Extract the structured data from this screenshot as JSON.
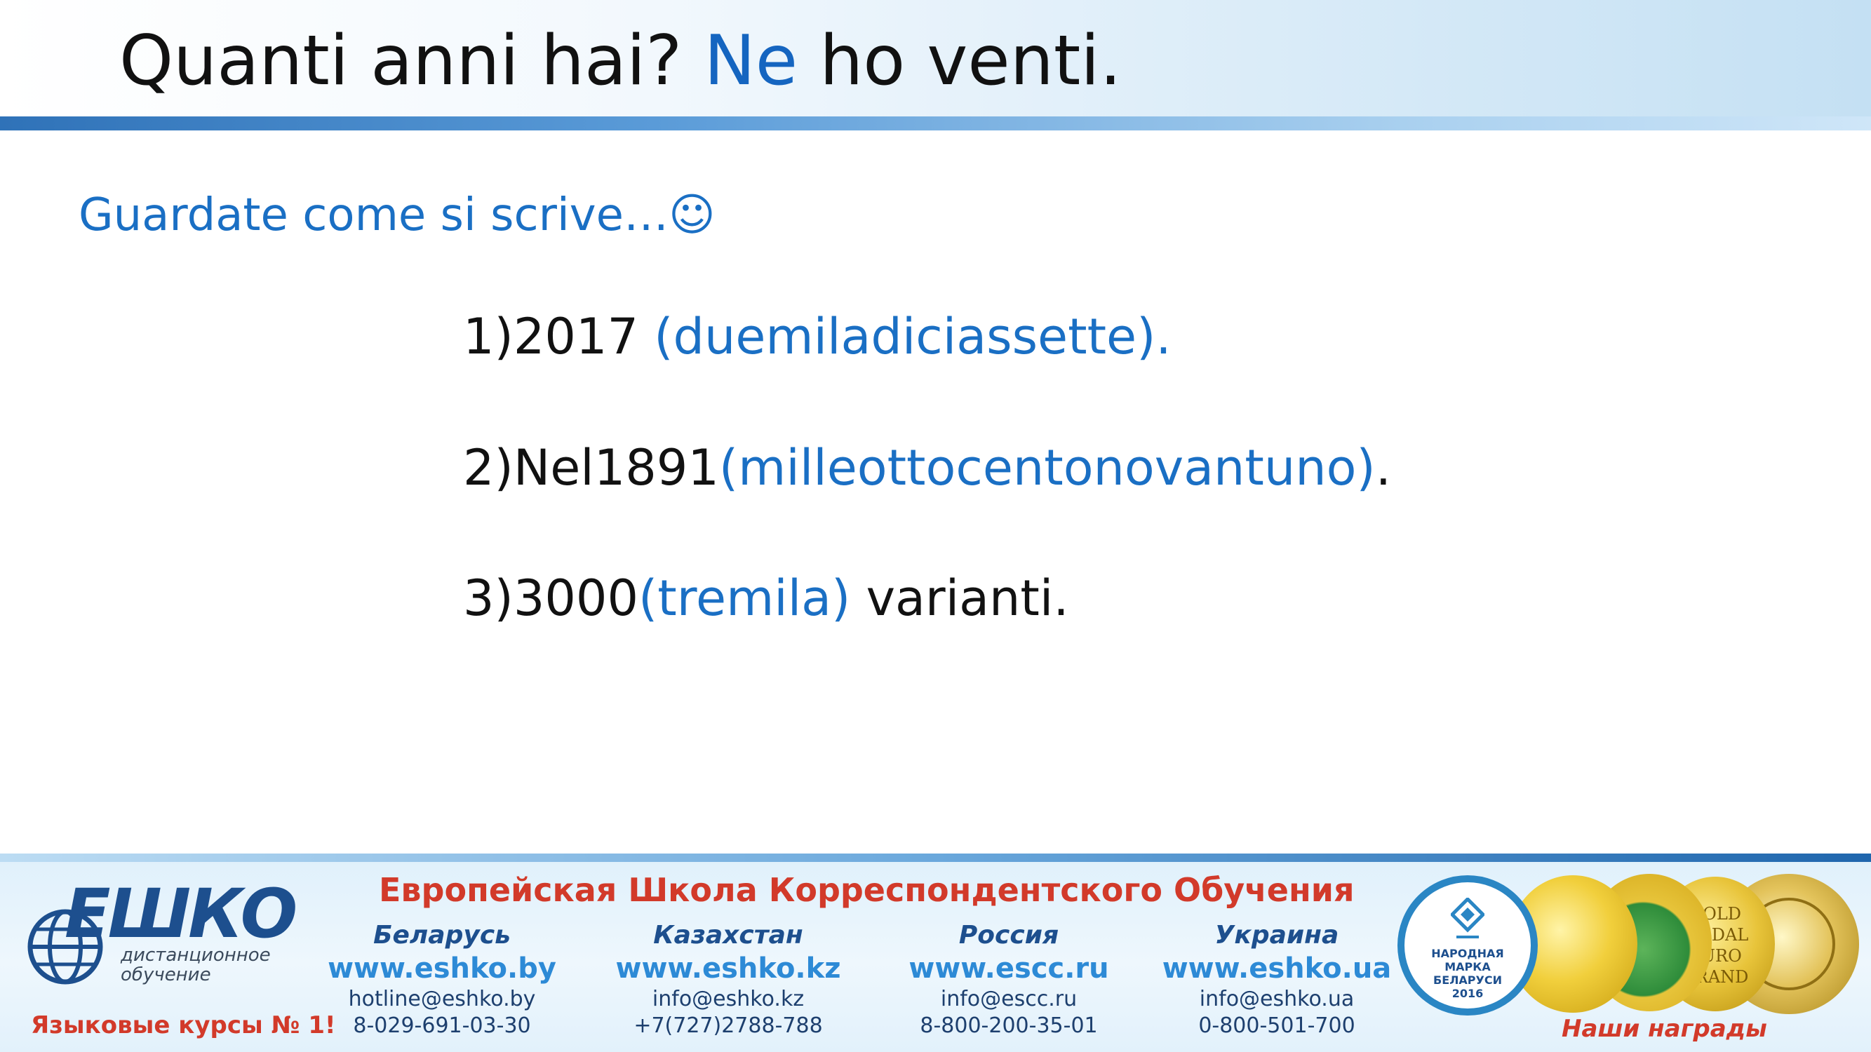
{
  "slide": {
    "title_part1": "Quanti anni hai? ",
    "title_highlight": "Ne",
    "title_part2": " ho venti.",
    "subtitle": "Guardate come si scrive…☺",
    "items": [
      {
        "num": "1)2017 ",
        "word": "(duemiladiciassette).",
        "tail": ""
      },
      {
        "num": "2)Nel1891",
        "word": "(milleottocentonovantuno)",
        "tail": "."
      },
      {
        "num": "3)3000",
        "word": "(tremila)",
        "tail": " varianti."
      }
    ]
  },
  "footer": {
    "logo_text": "ЕШКО",
    "logo_sub_line1": "дистанционное",
    "logo_sub_line2": "обучение",
    "courses": "Языковые курсы № 1!",
    "school_name": "Европейская Школа Корреспондентского Обучения",
    "countries": [
      {
        "name": "Беларусь",
        "web": "www.eshko.by",
        "email": "hotline@eshko.by",
        "phone": "8-029-691-03-30"
      },
      {
        "name": "Казахстан",
        "web": "www.eshko.kz",
        "email": "info@eshko.kz",
        "phone": "+7(727)2788-788"
      },
      {
        "name": "Россия",
        "web": "www.escc.ru",
        "email": "info@escc.ru",
        "phone": "8-800-200-35-01"
      },
      {
        "name": "Украина",
        "web": "www.eshko.ua",
        "email": "info@eshko.ua",
        "phone": "0-800-501-700"
      }
    ],
    "awards_label": "Наши награды",
    "medal_narod_line1": "НАРОДНАЯ",
    "medal_narod_line2": "МАРКА",
    "medal_narod_line3": "БЕЛАРУСИ",
    "medal_narod_line4": "2016",
    "medal_gold_line1": "GOLD",
    "medal_gold_line2": "MEDAL",
    "medal_gold_line3": "EURO",
    "medal_gold_line4": "GRAND"
  },
  "colors": {
    "accent_blue": "#1a6fc4",
    "brand_red": "#d23a2a",
    "brand_navy": "#1d4f8e"
  }
}
